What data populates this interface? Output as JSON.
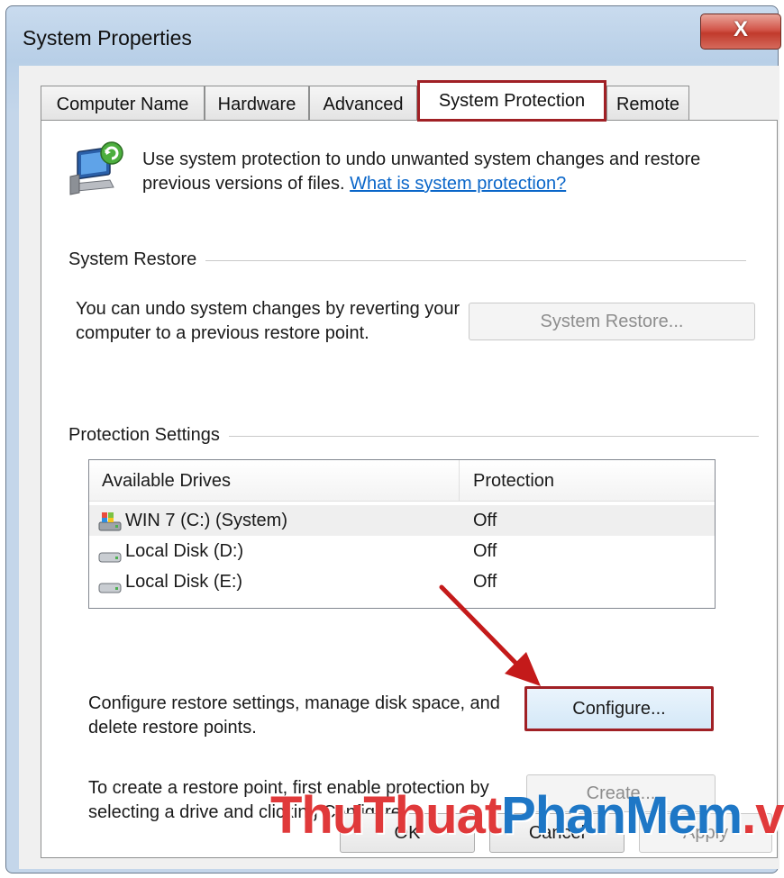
{
  "window": {
    "title": "System Properties",
    "close_label": "X"
  },
  "tabs": [
    {
      "label": "Computer Name",
      "active": false
    },
    {
      "label": "Hardware",
      "active": false
    },
    {
      "label": "Advanced",
      "active": false
    },
    {
      "label": "System Protection",
      "active": true
    },
    {
      "label": "Remote",
      "active": false
    }
  ],
  "intro": {
    "icon": "system-protection-icon",
    "text": "Use system protection to undo unwanted system changes and restore previous versions of files.",
    "link": "What is system protection?"
  },
  "system_restore": {
    "group_label": "System Restore",
    "description": "You can undo system changes by reverting your computer to a previous restore point.",
    "button": "System Restore..."
  },
  "protection_settings": {
    "group_label": "Protection Settings",
    "columns": [
      "Available Drives",
      "Protection"
    ],
    "drives": [
      {
        "name": "WIN 7 (C:) (System)",
        "protection": "Off",
        "icon": "system-drive-icon"
      },
      {
        "name": "Local Disk (D:)",
        "protection": "Off",
        "icon": "hard-drive-icon"
      },
      {
        "name": "Local Disk (E:)",
        "protection": "Off",
        "icon": "hard-drive-icon"
      }
    ],
    "configure_text": "Configure restore settings, manage disk space, and delete restore points.",
    "configure_button": "Configure...",
    "create_text": "To create a restore point, first enable protection by selecting a drive and clicking Configure.",
    "create_button": "Create..."
  },
  "footer_buttons": {
    "ok": "OK",
    "cancel": "Cancel",
    "apply": "Apply"
  },
  "watermark": {
    "part1": "ThuThuat",
    "part2": "PhanMem",
    "part3": ".vn",
    "colors": {
      "part1": "#e0393a",
      "part2": "#1e77c6",
      "part3": "#e0393a"
    }
  },
  "colors": {
    "highlight_border": "#a02025",
    "link": "#0a66c9",
    "arrow": "#c41a1a"
  }
}
